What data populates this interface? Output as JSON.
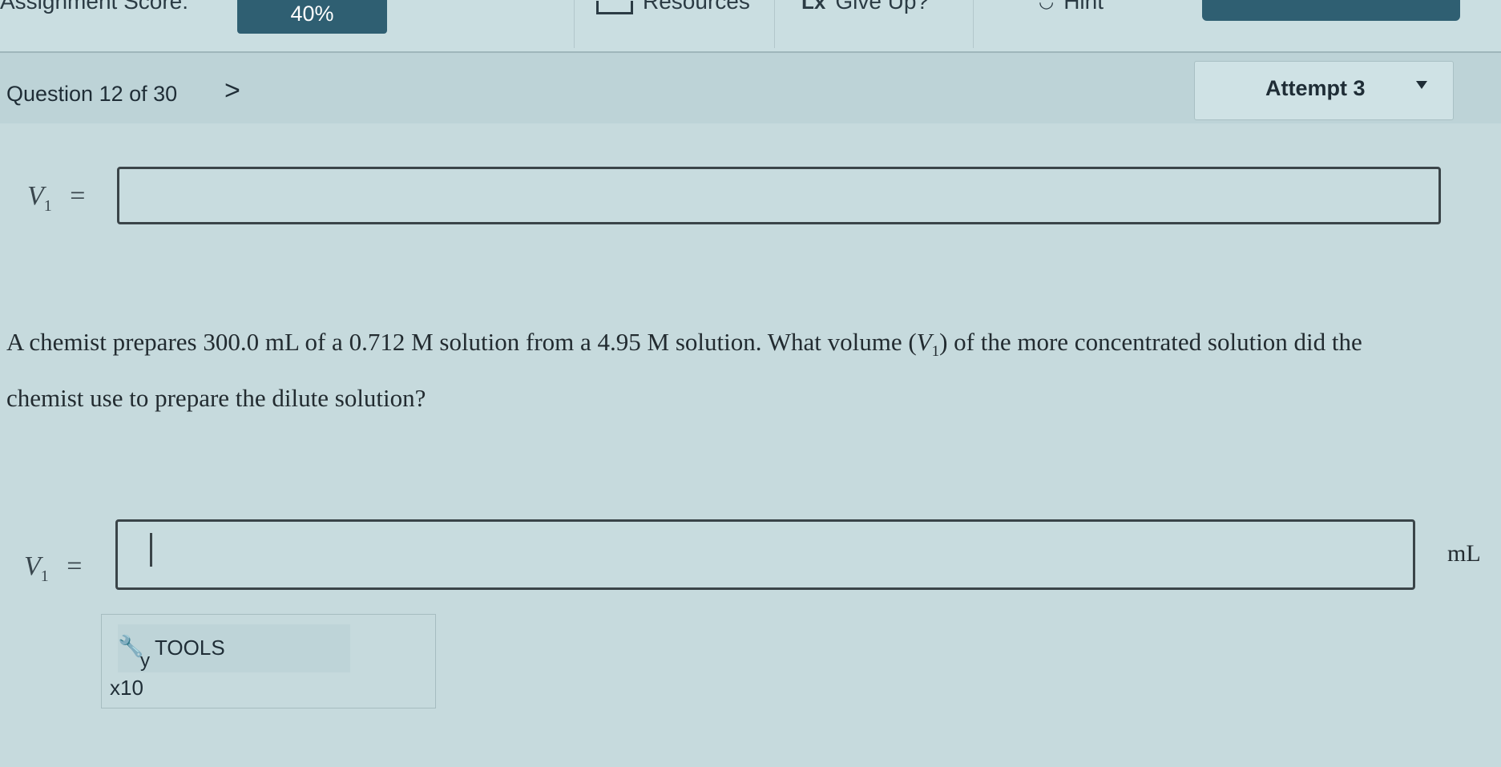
{
  "header": {
    "score_label": "Assignment Score:",
    "score_value": "40%",
    "resources_label": "Resources",
    "give_up_label": "Give Up?",
    "give_up_icon": "Lx",
    "hint_label": "Hint"
  },
  "question_bar": {
    "question_number": "Question 12 of 30",
    "next_icon": ">",
    "attempt_label": "Attempt 3"
  },
  "top_answer": {
    "variable": "V",
    "subscript": "1",
    "equals": "=",
    "value": ""
  },
  "question": {
    "part1": "A chemist prepares 300.0 mL of a 0.712 M solution from a 4.95 M solution. What volume (",
    "var": "V",
    "sub": "1",
    "part2": ") of the more concentrated solution did the chemist use to prepare the dilute solution?"
  },
  "answer": {
    "variable": "V",
    "subscript": "1",
    "equals": "=",
    "value": "",
    "unit": "mL"
  },
  "tools": {
    "label": "TOOLS",
    "superscript_hint": "y",
    "x10_label": "x10"
  },
  "colors": {
    "accent": "#2f5f72",
    "background": "#c6dadd"
  }
}
